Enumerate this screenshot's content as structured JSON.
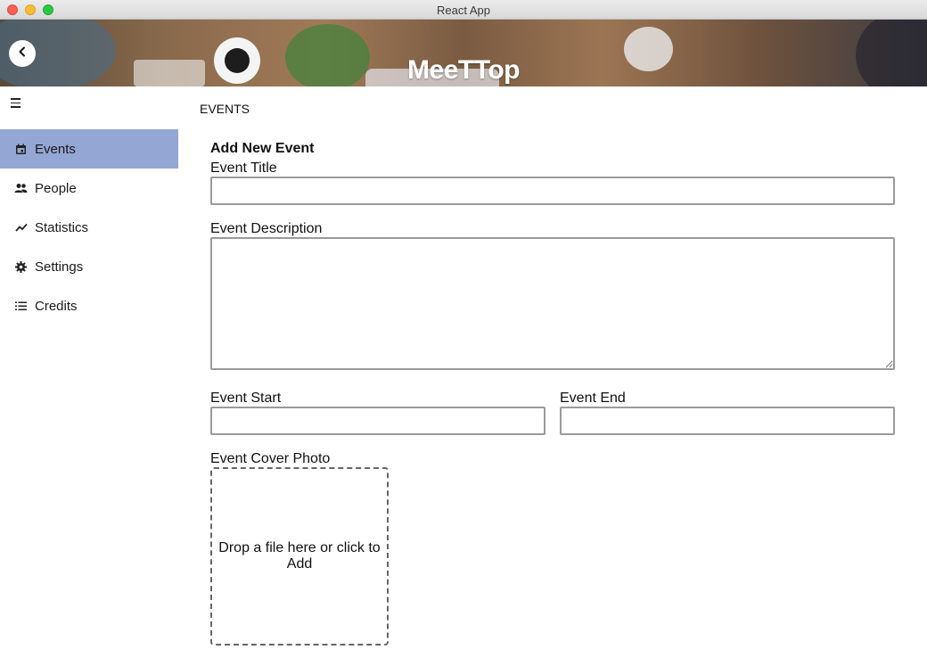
{
  "window": {
    "title": "React App"
  },
  "header": {
    "brand": "MeeTTop",
    "back_icon": "chevron-left-icon"
  },
  "menu_toggle_icon": "hamburger-icon",
  "sidebar": {
    "items": [
      {
        "label": "Events",
        "icon": "calendar-icon",
        "active": true
      },
      {
        "label": "People",
        "icon": "people-icon",
        "active": false
      },
      {
        "label": "Statistics",
        "icon": "trend-icon",
        "active": false
      },
      {
        "label": "Settings",
        "icon": "gear-icon",
        "active": false
      },
      {
        "label": "Credits",
        "icon": "list-icon",
        "active": false
      }
    ],
    "active_color": "#94a6d3"
  },
  "main": {
    "section_title": "EVENTS",
    "form": {
      "title": "Add New Event",
      "event_title_label": "Event Title",
      "event_title_value": "",
      "event_description_label": "Event Description",
      "event_description_value": "",
      "event_start_label": "Event Start",
      "event_start_value": "",
      "event_end_label": "Event End",
      "event_end_value": "",
      "cover_photo_label": "Event Cover Photo",
      "dropzone_text": "Drop a file here or click to Add"
    }
  }
}
